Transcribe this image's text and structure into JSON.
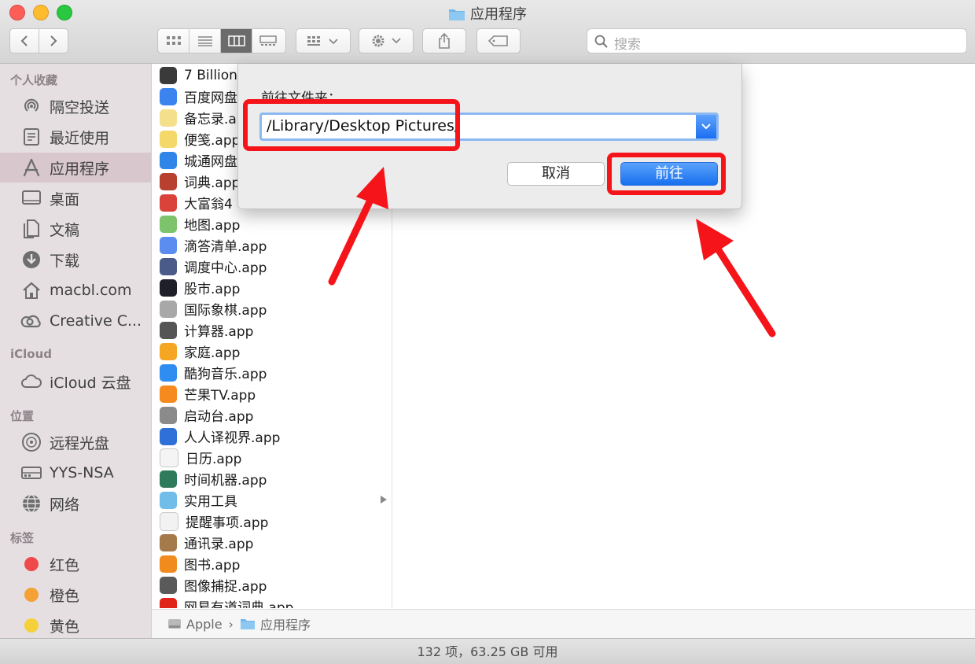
{
  "window": {
    "title": "应用程序",
    "colors": {
      "accent": "#1a6ff1",
      "annotation": "#f5141a",
      "sidebar_bg": "#e5dfe1"
    }
  },
  "toolbar": {
    "back_icon": "chevron-left-icon",
    "forward_icon": "chevron-right-icon",
    "view_modes": [
      "icon-view",
      "list-view",
      "column-view",
      "gallery-view"
    ],
    "active_view": "column-view",
    "search_placeholder": "搜索"
  },
  "sidebar": {
    "sections": [
      {
        "header": "个人收藏",
        "items": [
          {
            "label": "隔空投送",
            "icon": "airdrop-icon"
          },
          {
            "label": "最近使用",
            "icon": "recents-icon"
          },
          {
            "label": "应用程序",
            "icon": "applications-icon",
            "selected": true
          },
          {
            "label": "桌面",
            "icon": "desktop-icon"
          },
          {
            "label": "文稿",
            "icon": "documents-icon"
          },
          {
            "label": "下载",
            "icon": "downloads-icon"
          },
          {
            "label": "macbl.com",
            "icon": "home-icon"
          },
          {
            "label": "Creative C...",
            "icon": "creative-cloud-icon"
          }
        ]
      },
      {
        "header": "iCloud",
        "items": [
          {
            "label": "iCloud 云盘",
            "icon": "cloud-icon"
          }
        ]
      },
      {
        "header": "位置",
        "items": [
          {
            "label": "远程光盘",
            "icon": "disc-icon"
          },
          {
            "label": "YYS-NSA",
            "icon": "server-icon"
          },
          {
            "label": "网络",
            "icon": "globe-icon"
          }
        ]
      },
      {
        "header": "标签",
        "items": [
          {
            "label": "红色",
            "color": "#f0494a"
          },
          {
            "label": "橙色",
            "color": "#f5a136"
          },
          {
            "label": "黄色",
            "color": "#f6d03a"
          }
        ]
      }
    ]
  },
  "files": [
    {
      "name": "7 Billion",
      "color": "#3a3a3a"
    },
    {
      "name": "百度网盘",
      "color": "#3b84f0"
    },
    {
      "name": "备忘录.a",
      "color": "#f4e08b"
    },
    {
      "name": "便笺.app",
      "color": "#f5d86a"
    },
    {
      "name": "城通网盘",
      "color": "#2f86e8"
    },
    {
      "name": "词典.app",
      "color": "#b8402f"
    },
    {
      "name": "大富翁4",
      "color": "#d9433a"
    },
    {
      "name": "地图.app",
      "color": "#7cc36b"
    },
    {
      "name": "滴答清单.app",
      "color": "#5b8df0"
    },
    {
      "name": "调度中心.app",
      "color": "#4a5b8a"
    },
    {
      "name": "股市.app",
      "color": "#1f1f2a"
    },
    {
      "name": "国际象棋.app",
      "color": "#a8a8a8"
    },
    {
      "name": "计算器.app",
      "color": "#555555"
    },
    {
      "name": "家庭.app",
      "color": "#f5a623"
    },
    {
      "name": "酷狗音乐.app",
      "color": "#2f8cf0"
    },
    {
      "name": "芒果TV.app",
      "color": "#f68a1e"
    },
    {
      "name": "启动台.app",
      "color": "#8a8a8a"
    },
    {
      "name": "人人译视界.app",
      "color": "#2f6fd8"
    },
    {
      "name": "日历.app",
      "color": "#f4f4f4"
    },
    {
      "name": "时间机器.app",
      "color": "#2f7a5a"
    },
    {
      "name": "实用工具",
      "color": "#6fbde8",
      "folder": true
    },
    {
      "name": "提醒事项.app",
      "color": "#f2f2f2"
    },
    {
      "name": "通讯录.app",
      "color": "#a57a4a"
    },
    {
      "name": "图书.app",
      "color": "#f28b1e"
    },
    {
      "name": "图像捕捉.app",
      "color": "#5a5a5a"
    },
    {
      "name": "网易有道词典.app",
      "color": "#e2231a"
    }
  ],
  "dialog": {
    "prompt": "前往文件夹：",
    "path_value": "/Library/Desktop Pictures/",
    "cancel_label": "取消",
    "go_label": "前往"
  },
  "pathbar": {
    "crumbs": [
      "Apple",
      "应用程序"
    ],
    "separator": "›"
  },
  "status": {
    "text": "132 项，63.25 GB 可用"
  }
}
